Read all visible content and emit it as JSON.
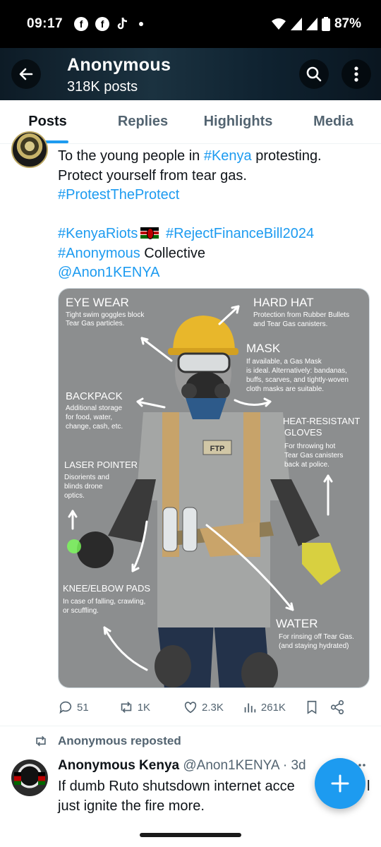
{
  "status_bar": {
    "time": "09:17",
    "app_icons": [
      "facebook-icon",
      "facebook-icon",
      "tiktok-icon"
    ],
    "battery": "87%"
  },
  "header": {
    "title": "Anonymous",
    "subtitle": "318K posts"
  },
  "tabs": [
    {
      "label": "Posts",
      "active": true
    },
    {
      "label": "Replies",
      "active": false
    },
    {
      "label": "Highlights",
      "active": false
    },
    {
      "label": "Media",
      "active": false
    }
  ],
  "tweet1": {
    "line1_prefix": "To the young people in ",
    "line1_tag": "#Kenya",
    "line1_suffix": " protesting.",
    "line2": "Protect yourself from tear gas.",
    "line3_tag": "#ProtestTheProtect",
    "line5_tag1": "#KenyaRiots",
    "line5_tag2": "#RejectFinanceBill2024",
    "line6_tag": "#Anonymous",
    "line6_suffix": " Collective",
    "line7_mention": "@Anon1KENYA",
    "media": {
      "eyewear_title": "EYE WEAR",
      "eyewear_l1": "Tight swim goggles block",
      "eyewear_l2": "Tear Gas particles.",
      "hardhat_title": "HARD HAT",
      "hardhat_l1": "Protection from Rubber Bullets",
      "hardhat_l2": "and Tear Gas canisters.",
      "mask_title": "MASK",
      "mask_l1": "If available, a Gas Mask",
      "mask_l2": "is ideal. Alternatively: bandanas,",
      "mask_l3": "buffs, scarves, and tightly-woven",
      "mask_l4": "cloth masks are suitable.",
      "backpack_title": "BACKPACK",
      "backpack_l1": "Additional storage",
      "backpack_l2": "for food, water,",
      "backpack_l3": "change, cash, etc.",
      "gloves_title1": "HEAT-RESISTANT",
      "gloves_title2": "GLOVES",
      "gloves_l1": "For throwing hot",
      "gloves_l2": "Tear Gas canisters",
      "gloves_l3": "back at police.",
      "laser_title": "LASER POINTER",
      "laser_l1": "Disorients and",
      "laser_l2": "blinds drone",
      "laser_l3": "optics.",
      "knee_title": "KNEE/ELBOW PADS",
      "knee_l1": "In case of falling, crawling,",
      "knee_l2": "or scuffling.",
      "water_title": "WATER",
      "water_l1": "For rinsing off Tear Gas.",
      "water_l2": "(and staying hydrated)",
      "shirt_badge": "FTP"
    },
    "actions": {
      "replies": "51",
      "reposts": "1K",
      "likes": "2.3K",
      "views": "261K"
    }
  },
  "tweet2": {
    "repost_label": "Anonymous reposted",
    "name": "Anonymous Kenya",
    "handle": "@Anon1KENYA · 3d",
    "line1": "If dumb Ruto shutsdown internet acce",
    "line1_end": "l",
    "line2": "just ignite the fire more."
  }
}
